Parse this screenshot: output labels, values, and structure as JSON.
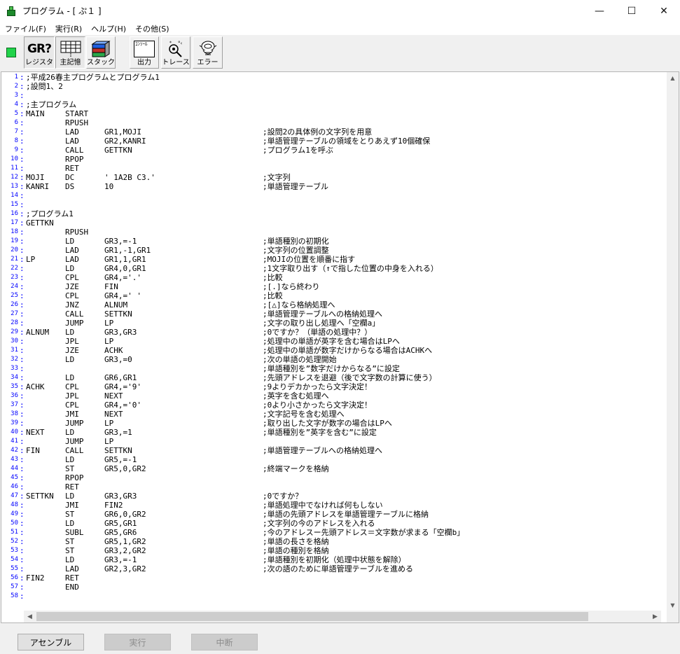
{
  "window": {
    "title": "プログラム - [ ぷ１ ]",
    "minimize": "—",
    "maximize": "☐",
    "close": "✕"
  },
  "menu": [
    "ファイル(F)",
    "実行(R)",
    "ヘルプ(H)",
    "その他(S)"
  ],
  "toolbar": {
    "buttons": [
      {
        "glyph": "GR?",
        "label": "レジスタ",
        "icon": "register-icon"
      },
      {
        "glyph": "",
        "label": "主記憶",
        "icon": "memory-grid-icon"
      },
      {
        "glyph": "",
        "label": "スタック",
        "icon": "stack-cube-icon"
      },
      {
        "glyph": "ｺﾝｿｰﾙ",
        "label": "出力",
        "icon": "console-output-icon"
      },
      {
        "glyph": "",
        "label": "トレース",
        "icon": "trace-magnifier-icon"
      },
      {
        "glyph": "",
        "label": "エラー",
        "icon": "error-bug-icon"
      }
    ],
    "status_color": "#21d34a"
  },
  "code": {
    "lines": [
      {
        "n": "1",
        "label": ";平成26春主プログラムとプログラム1",
        "op": "",
        "operand": "",
        "comment": ""
      },
      {
        "n": "2",
        "label": ";設問1、2",
        "op": "",
        "operand": "",
        "comment": ""
      },
      {
        "n": "3",
        "label": "",
        "op": "",
        "operand": "",
        "comment": ""
      },
      {
        "n": "4",
        "label": ";主プログラム",
        "op": "",
        "operand": "",
        "comment": ""
      },
      {
        "n": "5",
        "label": "MAIN",
        "op": "START",
        "operand": "",
        "comment": ""
      },
      {
        "n": "6",
        "label": "",
        "op": "RPUSH",
        "operand": "",
        "comment": ""
      },
      {
        "n": "7",
        "label": "",
        "op": "LAD",
        "operand": "GR1,MOJI",
        "comment": ";設問2の具体例の文字列を用意"
      },
      {
        "n": "8",
        "label": "",
        "op": "LAD",
        "operand": "GR2,KANRI",
        "comment": ";単語管理テーブルの領域をとりあえず10個確保"
      },
      {
        "n": "9",
        "label": "",
        "op": "CALL",
        "operand": "GETTKN",
        "comment": ";プログラム1を呼ぶ"
      },
      {
        "n": "10",
        "label": "",
        "op": "RPOP",
        "operand": "",
        "comment": ""
      },
      {
        "n": "11",
        "label": "",
        "op": "RET",
        "operand": "",
        "comment": ""
      },
      {
        "n": "12",
        "label": "MOJI",
        "op": "DC",
        "operand": "' 1A2B C3.'",
        "comment": ";文字列"
      },
      {
        "n": "13",
        "label": "KANRI",
        "op": "DS",
        "operand": "10",
        "comment": ";単語管理テーブル"
      },
      {
        "n": "14",
        "label": "",
        "op": "",
        "operand": "",
        "comment": ""
      },
      {
        "n": "15",
        "label": "",
        "op": "",
        "operand": "",
        "comment": ""
      },
      {
        "n": "16",
        "label": ";プログラム1",
        "op": "",
        "operand": "",
        "comment": ""
      },
      {
        "n": "17",
        "label": "GETTKN",
        "op": "",
        "operand": "",
        "comment": ""
      },
      {
        "n": "18",
        "label": "",
        "op": "RPUSH",
        "operand": "",
        "comment": ""
      },
      {
        "n": "19",
        "label": "",
        "op": "LD",
        "operand": "GR3,=-1",
        "comment": ";単語種別の初期化"
      },
      {
        "n": "20",
        "label": "",
        "op": "LAD",
        "operand": "GR1,-1,GR1",
        "comment": ";文字列の位置調整"
      },
      {
        "n": "21",
        "label": "LP",
        "op": "LAD",
        "operand": "GR1,1,GR1",
        "comment": ";MOJIの位置を順番に指す"
      },
      {
        "n": "22",
        "label": "",
        "op": "LD",
        "operand": "GR4,0,GR1",
        "comment": ";1文字取り出す（↑で指した位置の中身を入れる）"
      },
      {
        "n": "23",
        "label": "",
        "op": "CPL",
        "operand": "GR4,='.'",
        "comment": ";比較"
      },
      {
        "n": "24",
        "label": "",
        "op": "JZE",
        "operand": "FIN",
        "comment": ";[.]なら終わり"
      },
      {
        "n": "25",
        "label": "",
        "op": "CPL",
        "operand": "GR4,=' '",
        "comment": ";比較"
      },
      {
        "n": "26",
        "label": "",
        "op": "JNZ",
        "operand": "ALNUM",
        "comment": ";[△]なら格納処理へ"
      },
      {
        "n": "27",
        "label": "",
        "op": "CALL",
        "operand": "SETTKN",
        "comment": ";単語管理テーブルへの格納処理へ"
      },
      {
        "n": "28",
        "label": "",
        "op": "JUMP",
        "operand": "LP",
        "comment": ";文字の取り出し処理へ「空欄a」"
      },
      {
        "n": "29",
        "label": "ALNUM",
        "op": "LD",
        "operand": "GR3,GR3",
        "comment": ";0ですか？（単語の処理中？）"
      },
      {
        "n": "30",
        "label": "",
        "op": "JPL",
        "operand": "LP",
        "comment": ";処理中の単語が英字を含む場合はLPへ"
      },
      {
        "n": "31",
        "label": "",
        "op": "JZE",
        "operand": "ACHK",
        "comment": ";処理中の単語が数字だけからなる場合はACHKへ"
      },
      {
        "n": "32",
        "label": "",
        "op": "LD",
        "operand": "GR3,=0",
        "comment": ";次の単語の処理開始"
      },
      {
        "n": "33",
        "label": "",
        "op": "",
        "operand": "",
        "comment": ";単語種別を”数字だけからなる”に設定"
      },
      {
        "n": "34",
        "label": "",
        "op": "LD",
        "operand": "GR6,GR1",
        "comment": ";先頭アドレスを退避（後で文字数の計算に使う）"
      },
      {
        "n": "35",
        "label": "ACHK",
        "op": "CPL",
        "operand": "GR4,='9'",
        "comment": ";9よりデカかったら文字決定！"
      },
      {
        "n": "36",
        "label": "",
        "op": "JPL",
        "operand": "NEXT",
        "comment": ";英字を含む処理へ"
      },
      {
        "n": "37",
        "label": "",
        "op": "CPL",
        "operand": "GR4,='0'",
        "comment": ";0より小さかったら文字決定！"
      },
      {
        "n": "38",
        "label": "",
        "op": "JMI",
        "operand": "NEXT",
        "comment": ";文字記号を含む処理へ"
      },
      {
        "n": "39",
        "label": "",
        "op": "JUMP",
        "operand": "LP",
        "comment": ";取り出した文字が数字の場合はLPへ"
      },
      {
        "n": "40",
        "label": "NEXT",
        "op": "LD",
        "operand": "GR3,=1",
        "comment": ";単語種別を”英字を含む”に設定"
      },
      {
        "n": "41",
        "label": "",
        "op": "JUMP",
        "operand": "LP",
        "comment": ""
      },
      {
        "n": "42",
        "label": "FIN",
        "op": "CALL",
        "operand": "SETTKN",
        "comment": ";単語管理テーブルへの格納処理へ"
      },
      {
        "n": "43",
        "label": "",
        "op": "LD",
        "operand": "GR5,=-1",
        "comment": ""
      },
      {
        "n": "44",
        "label": "",
        "op": "ST",
        "operand": "GR5,0,GR2",
        "comment": ";終端マークを格納"
      },
      {
        "n": "45",
        "label": "",
        "op": "RPOP",
        "operand": "",
        "comment": ""
      },
      {
        "n": "46",
        "label": "",
        "op": "RET",
        "operand": "",
        "comment": ""
      },
      {
        "n": "47",
        "label": "SETTKN",
        "op": "LD",
        "operand": "GR3,GR3",
        "comment": ";0ですか？"
      },
      {
        "n": "48",
        "label": "",
        "op": "JMI",
        "operand": "FIN2",
        "comment": ";単語処理中でなければ何もしない"
      },
      {
        "n": "49",
        "label": "",
        "op": "ST",
        "operand": "GR6,0,GR2",
        "comment": ";単語の先頭アドレスを単語管理テーブルに格納"
      },
      {
        "n": "50",
        "label": "",
        "op": "LD",
        "operand": "GR5,GR1",
        "comment": ";文字列の今のアドレスを入れる"
      },
      {
        "n": "51",
        "label": "",
        "op": "SUBL",
        "operand": "GR5,GR6",
        "comment": ";今のアドレスー先頭アドレス＝文字数が求まる「空欄b」"
      },
      {
        "n": "52",
        "label": "",
        "op": "ST",
        "operand": "GR5,1,GR2",
        "comment": ";単語の長さを格納"
      },
      {
        "n": "53",
        "label": "",
        "op": "ST",
        "operand": "GR3,2,GR2",
        "comment": ";単語の種別を格納"
      },
      {
        "n": "54",
        "label": "",
        "op": "LD",
        "operand": "GR3,=-1",
        "comment": ";単語種別を初期化（処理中状態を解除）"
      },
      {
        "n": "55",
        "label": "",
        "op": "LAD",
        "operand": "GR2,3,GR2",
        "comment": ";次の語のために単語管理テーブルを進める"
      },
      {
        "n": "56",
        "label": "FIN2",
        "op": "RET",
        "operand": "",
        "comment": ""
      },
      {
        "n": "57",
        "label": "",
        "op": "END",
        "operand": "",
        "comment": ""
      },
      {
        "n": "58",
        "label": "",
        "op": "",
        "operand": "",
        "comment": ""
      }
    ]
  },
  "bottom": {
    "assemble": "アセンブル",
    "run": "実行",
    "stop": "中断"
  }
}
